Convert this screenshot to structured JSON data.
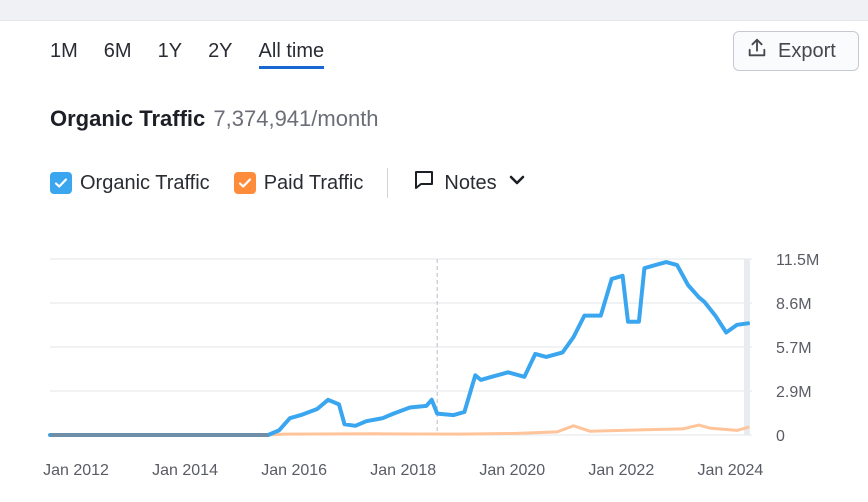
{
  "range_tabs": [
    {
      "label": "1M",
      "active": false
    },
    {
      "label": "6M",
      "active": false
    },
    {
      "label": "1Y",
      "active": false
    },
    {
      "label": "2Y",
      "active": false
    },
    {
      "label": "All time",
      "active": true
    }
  ],
  "export": {
    "label": "Export",
    "icon": "upload-icon"
  },
  "title": {
    "main": "Organic Traffic",
    "value": "7,374,941/month"
  },
  "legend": {
    "organic": {
      "label": "Organic Traffic",
      "color": "#3aa6f0",
      "checked": true
    },
    "paid": {
      "label": "Paid Traffic",
      "color": "#ff8c3a",
      "checked": true
    },
    "notes": {
      "label": "Notes",
      "icon": "comment-icon"
    }
  },
  "chart_data": {
    "type": "line",
    "title": "Organic Traffic",
    "ylim": [
      0,
      11500000
    ],
    "y_ticks": [
      "11.5M",
      "8.6M",
      "5.7M",
      "2.9M",
      "0"
    ],
    "x_ticks": [
      "Jan 2012",
      "Jan 2014",
      "Jan 2016",
      "Jan 2018",
      "Jan 2020",
      "Jan 2022",
      "Jan 2024"
    ],
    "grid": true,
    "legend_position": "top-left",
    "series": [
      {
        "name": "Organic Traffic",
        "color": "#3aa6f0",
        "points": [
          [
            2012.0,
            0
          ],
          [
            2016.0,
            0
          ],
          [
            2016.2,
            300000
          ],
          [
            2016.4,
            1100000
          ],
          [
            2016.6,
            1300000
          ],
          [
            2016.9,
            1700000
          ],
          [
            2017.1,
            2300000
          ],
          [
            2017.3,
            2000000
          ],
          [
            2017.4,
            700000
          ],
          [
            2017.6,
            600000
          ],
          [
            2017.8,
            900000
          ],
          [
            2018.1,
            1100000
          ],
          [
            2018.3,
            1400000
          ],
          [
            2018.6,
            1800000
          ],
          [
            2018.9,
            1900000
          ],
          [
            2019.0,
            2300000
          ],
          [
            2019.1,
            1400000
          ],
          [
            2019.4,
            1300000
          ],
          [
            2019.6,
            1500000
          ],
          [
            2019.8,
            3900000
          ],
          [
            2019.9,
            3600000
          ],
          [
            2020.1,
            3800000
          ],
          [
            2020.4,
            4100000
          ],
          [
            2020.7,
            3800000
          ],
          [
            2020.9,
            5300000
          ],
          [
            2021.1,
            5100000
          ],
          [
            2021.4,
            5400000
          ],
          [
            2021.6,
            6400000
          ],
          [
            2021.8,
            7800000
          ],
          [
            2022.1,
            7800000
          ],
          [
            2022.3,
            10200000
          ],
          [
            2022.5,
            10400000
          ],
          [
            2022.6,
            7400000
          ],
          [
            2022.8,
            7400000
          ],
          [
            2022.9,
            10900000
          ],
          [
            2023.1,
            11100000
          ],
          [
            2023.3,
            11300000
          ],
          [
            2023.5,
            11100000
          ],
          [
            2023.7,
            9800000
          ],
          [
            2023.9,
            9000000
          ],
          [
            2024.0,
            8700000
          ],
          [
            2024.2,
            7800000
          ],
          [
            2024.4,
            6700000
          ],
          [
            2024.6,
            7200000
          ],
          [
            2024.8,
            7300000
          ]
        ]
      },
      {
        "name": "Paid Traffic",
        "color": "#ffc49a",
        "points": [
          [
            2012.0,
            0
          ],
          [
            2016.0,
            0
          ],
          [
            2016.3,
            60000
          ],
          [
            2018.0,
            80000
          ],
          [
            2019.5,
            60000
          ],
          [
            2020.5,
            100000
          ],
          [
            2021.3,
            200000
          ],
          [
            2021.6,
            600000
          ],
          [
            2021.9,
            250000
          ],
          [
            2022.5,
            300000
          ],
          [
            2023.0,
            350000
          ],
          [
            2023.6,
            400000
          ],
          [
            2023.9,
            650000
          ],
          [
            2024.1,
            450000
          ],
          [
            2024.6,
            300000
          ],
          [
            2024.8,
            500000
          ]
        ]
      }
    ]
  }
}
